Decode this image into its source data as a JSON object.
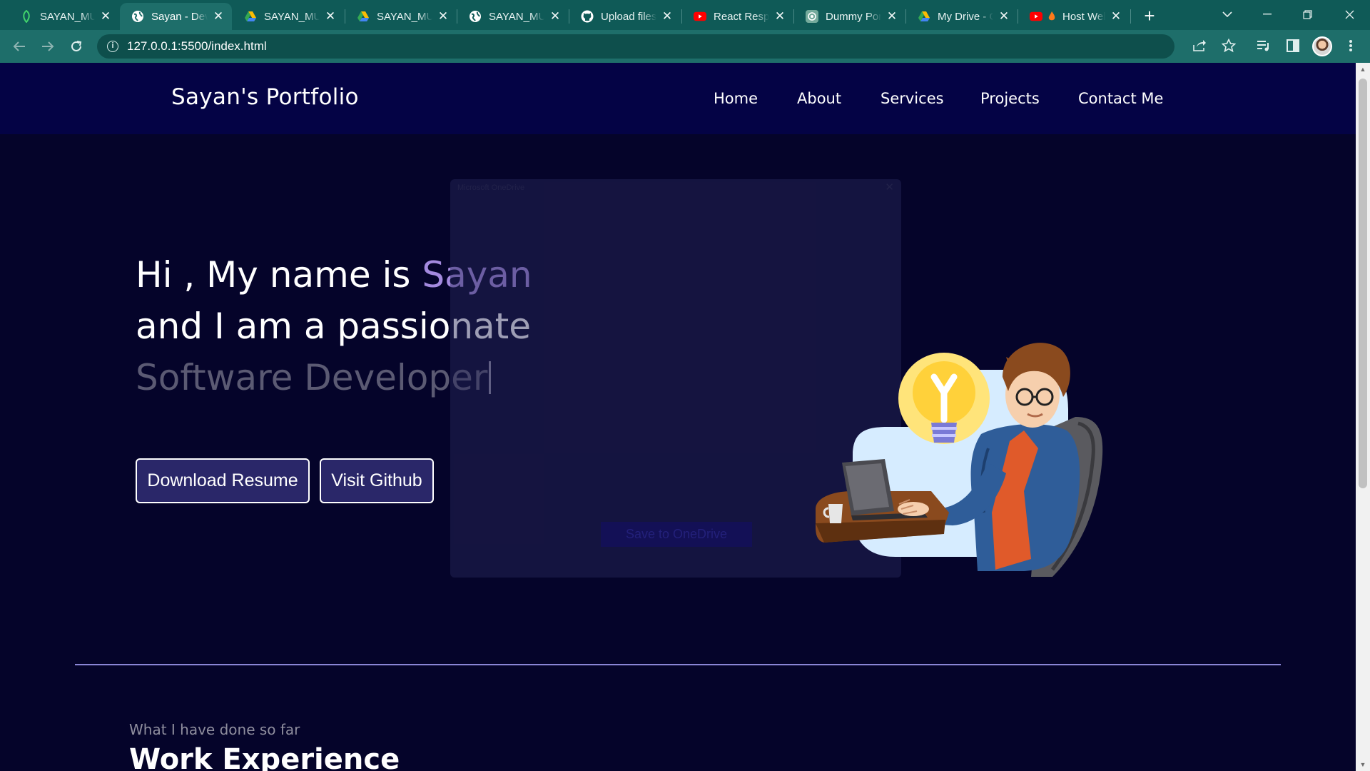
{
  "browser": {
    "tabs": [
      {
        "title": "SAYAN_MUKHERJEE",
        "icon": "leaf-icon",
        "active": false
      },
      {
        "title": "Sayan - Developer",
        "icon": "globe-icon",
        "active": true
      },
      {
        "title": "SAYAN_MUKHERJEE",
        "icon": "drive-icon",
        "active": false
      },
      {
        "title": "SAYAN_MUKHERJEE",
        "icon": "drive-icon",
        "active": false
      },
      {
        "title": "SAYAN_MUKHERJEE",
        "icon": "globe-icon",
        "active": false
      },
      {
        "title": "Upload files",
        "icon": "github-icon",
        "active": false
      },
      {
        "title": "React Responsive",
        "icon": "youtube-icon",
        "active": false
      },
      {
        "title": "Dummy Portfolio",
        "icon": "chatgpt-icon",
        "active": false
      },
      {
        "title": "My Drive - Google",
        "icon": "drive-icon",
        "active": false
      },
      {
        "title": "Host Website",
        "icon": "youtube-icon",
        "active": false
      }
    ],
    "url": "127.0.0.1:5500/index.html"
  },
  "site": {
    "brand": "Sayan's Portfolio",
    "nav": [
      "Home",
      "About",
      "Services",
      "Projects",
      "Contact Me"
    ],
    "hero": {
      "line1_prefix": "Hi , My name is ",
      "name": "Sayan",
      "line2": "and I am a passionate",
      "typed": "Software Developer"
    },
    "buttons": {
      "resume": "Download Resume",
      "github": "Visit Github"
    },
    "section": {
      "subtitle": "What I have done so far",
      "title": "Work Experience"
    }
  },
  "overlay": {
    "title": "Microsoft OneDrive",
    "button": "Save to OneDrive"
  },
  "colors": {
    "page_bg": "#05042a",
    "navbar_bg": "#040345",
    "accent": "#a48adf",
    "tab_bar": "#0f5a57"
  }
}
